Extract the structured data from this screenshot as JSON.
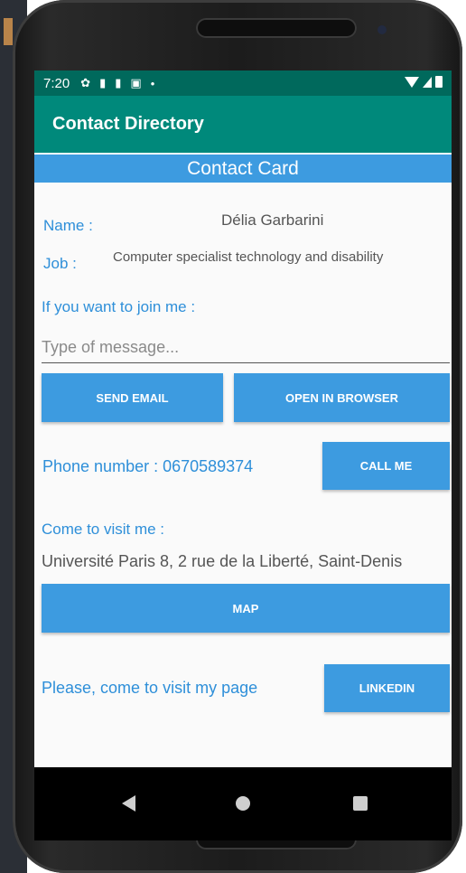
{
  "status_bar": {
    "time": "7:20",
    "icons": [
      "gear-icon",
      "person-icon",
      "person-icon",
      "sim-icon",
      "dot-icon"
    ],
    "right_icons": [
      "wifi-icon",
      "signal-icon",
      "battery-icon"
    ]
  },
  "app_bar": {
    "title": "Contact Directory"
  },
  "header": {
    "title": "Contact Card"
  },
  "contact": {
    "name_label": "Name :",
    "name_value": "Délia Garbarini",
    "job_label": "Job :",
    "job_value": "Computer specialist technology and disability"
  },
  "join": {
    "label": "If you want to join me :",
    "message_placeholder": "Type of message...",
    "send_email_label": "SEND EMAIL",
    "open_browser_label": "OPEN IN BROWSER"
  },
  "phone": {
    "label": "Phone number : 0670589374",
    "call_label": "CALL ME"
  },
  "visit": {
    "label": "Come to visit me :",
    "address": "Université Paris 8, 2 rue de la Liberté, Saint-Denis",
    "map_label": "MAP"
  },
  "linkedin": {
    "label": "Please, come to visit my page",
    "button_label": "LINKEDIN"
  },
  "nav": {
    "icons": [
      "back-icon",
      "home-icon",
      "recents-icon"
    ]
  },
  "colors": {
    "status_bar": "#00695c",
    "app_bar": "#00897b",
    "accent": "#3d9be0",
    "label_text": "#2e8fd9"
  }
}
